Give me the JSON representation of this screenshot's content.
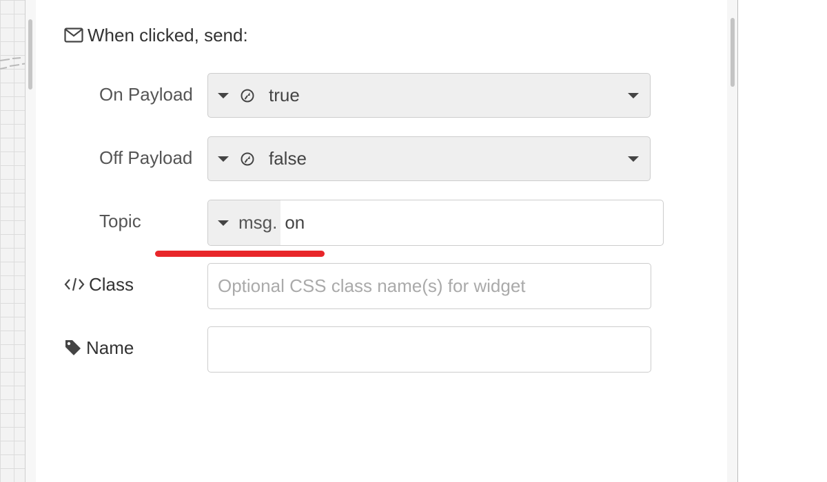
{
  "section": {
    "title": "When clicked, send:",
    "icon": "envelope-icon"
  },
  "fields": {
    "on_payload": {
      "label": "On Payload",
      "type_icon": "boolean-icon",
      "value": "true"
    },
    "off_payload": {
      "label": "Off Payload",
      "type_icon": "boolean-icon",
      "value": "false"
    },
    "topic": {
      "label": "Topic",
      "prefix": "msg.",
      "value": "on"
    },
    "class": {
      "label": "Class",
      "icon": "code-icon",
      "value": "",
      "placeholder": "Optional CSS class name(s) for widget"
    },
    "name": {
      "label": "Name",
      "icon": "tag-icon",
      "value": ""
    }
  },
  "colors": {
    "annotation": "#e8262a",
    "select_background": "#efefef",
    "border": "#cccccc"
  }
}
